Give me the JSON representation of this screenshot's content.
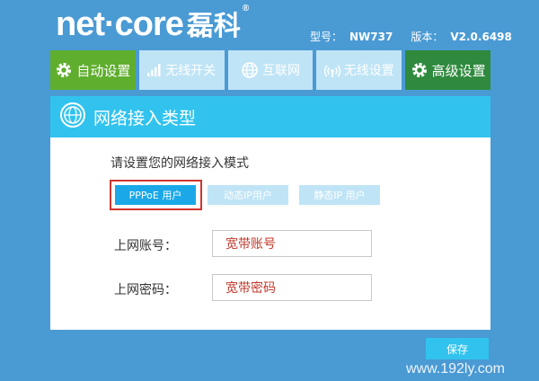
{
  "brand": {
    "latin": "net·core",
    "cn": "磊科",
    "reg": "®"
  },
  "device": {
    "model_label": "型号：",
    "model_value": "NW737",
    "version_label": "版本：",
    "version_value": "V2.0.6498"
  },
  "nav": {
    "items": [
      {
        "label": "自动设置",
        "icon": "gear-icon"
      },
      {
        "label": "无线开关",
        "icon": "signal-bars-icon"
      },
      {
        "label": "互联网",
        "icon": "globe-icon"
      },
      {
        "label": "无线设置",
        "icon": "wifi-icon"
      },
      {
        "label": "高级设置",
        "icon": "gear-icon"
      }
    ]
  },
  "panel": {
    "title": "网络接入类型",
    "mode_prompt": "请设置您的网络接入模式",
    "modes": [
      {
        "label": "PPPoE 用户",
        "selected": true
      },
      {
        "label": "动态IP用户",
        "selected": false
      },
      {
        "label": "静态IP 用户",
        "selected": false
      }
    ],
    "fields": {
      "account_label": "上网账号：",
      "account_value": "宽带账号",
      "password_label": "上网密码：",
      "password_value": "宽带密码"
    }
  },
  "save_label": "保存",
  "watermark": "www.192ly.com",
  "colors": {
    "page_bg": "#4a9ad4",
    "nav_green": "#5fae2e",
    "nav_light": "#bfe4f6",
    "nav_dark_green": "#2f8a3e",
    "header_cyan": "#31c3ee",
    "active_mode": "#1aa8e8",
    "highlight_red": "#d0352d",
    "value_red": "#c0392b"
  }
}
